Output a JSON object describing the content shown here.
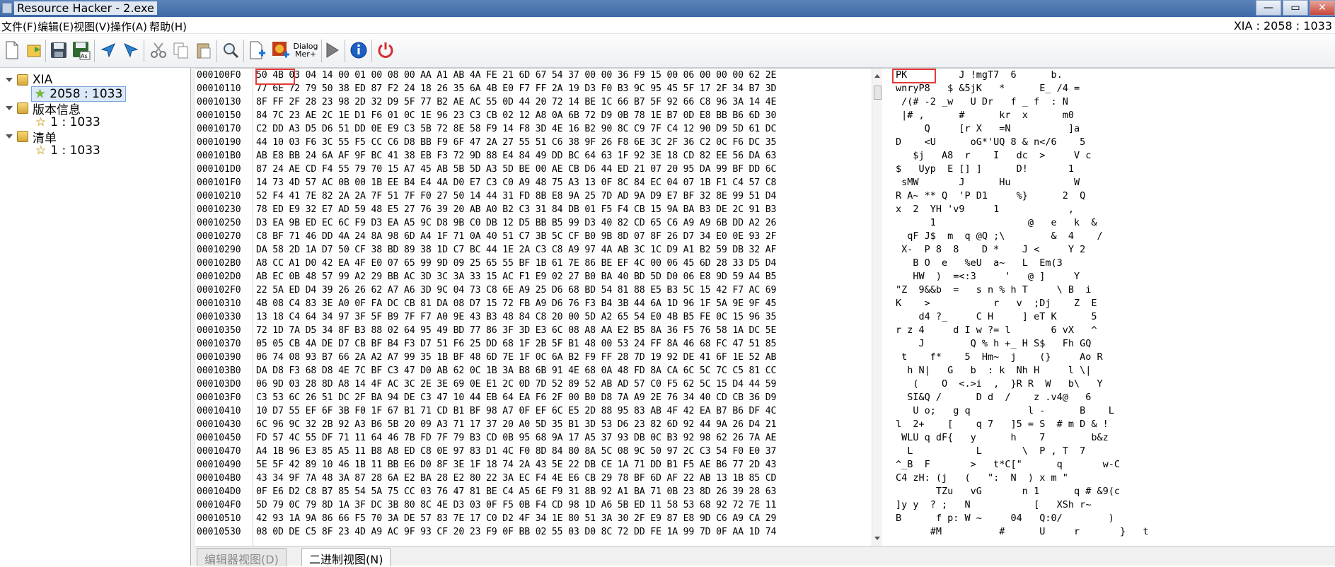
{
  "window": {
    "title": "Resource Hacker - 2.exe",
    "btn_min": "—",
    "btn_max": "▭",
    "btn_close": "✕"
  },
  "menu": {
    "items": [
      "文件(F)",
      "编辑(E)",
      "视图(V)",
      "操作(A)",
      "帮助(H)"
    ],
    "status": "XIA : 2058 : 1033"
  },
  "toolbar": {
    "dialog_menu_label1": "Dialog",
    "dialog_menu_label2": "Mer+"
  },
  "tree": {
    "n1": "XIA",
    "n1c": "2058 : 1033",
    "n2": "版本信息",
    "n2c": "1 : 1033",
    "n3": "清单",
    "n3c": "1 : 1033"
  },
  "hex": {
    "offsets": [
      "000100F0",
      "00010110",
      "00010130",
      "00010150",
      "00010170",
      "00010190",
      "000101B0",
      "000101D0",
      "000101F0",
      "00010210",
      "00010230",
      "00010250",
      "00010270",
      "00010290",
      "000102B0",
      "000102D0",
      "000102F0",
      "00010310",
      "00010330",
      "00010350",
      "00010370",
      "00010390",
      "000103B0",
      "000103D0",
      "000103F0",
      "00010410",
      "00010430",
      "00010450",
      "00010470",
      "00010490",
      "000104B0",
      "000104D0",
      "000104F0",
      "00010510",
      "00010530"
    ],
    "rows": [
      "50 4B 03 04 14 00 01 00 08 00 AA A1 AB 4A FE 21 6D 67 54 37 00 00 36 F9 15 00 06 00 00 00 62 2E",
      "77 6E 72 79 50 38 ED 87 F2 24 18 26 35 6A 4B E0 F7 FF 2A 19 D3 F0 B3 9C 95 45 5F 17 2F 34 B7 3D",
      "8F FF 2F 28 23 98 2D 32 D9 5F 77 B2 AE AC 55 0D 44 20 72 14 BE 1C 66 B7 5F 92 66 C8 96 3A 14 4E",
      "84 7C 23 AE 2C 1E D1 F6 01 0C 1E 96 23 C3 CB 02 12 A8 0A 6B 72 D9 0B 78 1E B7 0D E8 BB B6 6D 30",
      "C2 DD A3 D5 D6 51 DD 0E E9 C3 5B 72 8E 58 F9 14 F8 3D 4E 16 B2 90 8C C9 7F C4 12 90 D9 5D 61 DC",
      "44 10 03 F6 3C 55 F5 CC C6 D8 BB F9 6F 47 2A 27 55 51 C6 38 9F 26 F8 6E 3C 2F 36 C2 0C F6 DC 35",
      "AB E8 BB 24 6A AF 9F BC 41 38 EB F3 72 9D 88 E4 84 49 DD BC 64 63 1F 92 3E 18 CD 82 EE 56 DA 63",
      "87 24 AE CD F4 55 79 70 15 A7 45 AB 5B 5D A3 5D BE 00 AE CB D6 44 ED 21 07 20 95 DA 99 BF DD 6C",
      "14 73 4D 57 AC 0B 00 1B EE B4 E4 4A D0 E7 C3 C0 A9 48 75 A3 13 0F 8C 84 EC 04 07 1B F1 C4 57 C8",
      "52 F4 41 7E 82 2A 2A 7F 51 7F F0 27 50 14 44 31 FD 8B E8 9A 25 7D AD 9A D9 E7 BF 32 8E 99 51 D4",
      "78 ED E9 32 E7 AD 59 48 E5 27 76 39 20 AB A0 B2 C3 31 84 DB 01 F5 F4 CB 15 9A BA B3 DE 2C 91 B3",
      "D3 EA 9B ED EC 6C F9 D3 EA A5 9C D8 9B C0 DB 12 D5 BB B5 99 D3 40 82 CD 65 C6 A9 A9 6B DD A2 26",
      "C8 BF 71 46 DD 4A 24 8A 98 6D A4 1F 71 0A 40 51 C7 3B 5C CF B0 9B 8D 07 8F 26 D7 34 E0 0E 93 2F",
      "DA 58 2D 1A D7 50 CF 38 BD 89 38 1D C7 BC 44 1E 2A C3 C8 A9 97 4A AB 3C 1C D9 A1 B2 59 DB 32 AF",
      "A8 CC A1 D0 42 EA 4F E0 07 65 99 9D 09 25 65 55 BF 1B 61 7E 86 BE EF 4C 00 06 45 6D 28 33 D5 D4",
      "AB EC 0B 48 57 99 A2 29 BB AC 3D 3C 3A 33 15 AC F1 E9 02 27 B0 BA 40 BD 5D D0 06 E8 9D 59 A4 B5",
      "22 5A ED D4 39 26 26 62 A7 A6 3D 9C 04 73 C8 6E A9 25 D6 68 BD 54 81 88 E5 B3 5C 15 42 F7 AC 69",
      "4B 08 C4 83 3E A0 0F FA DC CB 81 DA 08 D7 15 72 FB A9 D6 76 F3 B4 3B 44 6A 1D 96 1F 5A 9E 9F 45",
      "13 18 C4 64 34 97 3F 5F B9 7F F7 A0 9E 43 B3 48 84 C8 20 00 5D A2 65 54 E0 4B B5 FE 0C 15 96 35",
      "72 1D 7A D5 34 8F B3 88 02 64 95 49 BD 77 86 3F 3D E3 6C 08 A8 AA E2 B5 8A 36 F5 76 58 1A DC 5E",
      "05 05 CB 4A DE D7 CB BF B4 F3 D7 51 F6 25 DD 68 1F 2B 5F B1 48 00 53 24 FF 8A 46 68 FC 47 51 85",
      "06 74 08 93 B7 66 2A A2 A7 99 35 1B BF 48 6D 7E 1F 0C 6A B2 F9 FF 28 7D 19 92 DE 41 6F 1E 52 AB",
      "DA D8 F3 68 D8 4E 7C BF C3 47 D0 AB 62 0C 1B 3A B8 6B 91 4E 68 0A 48 FD 8A CA 6C 5C 7C C5 81 CC",
      "06 9D 03 28 8D A8 14 4F AC 3C 2E 3E 69 0E E1 2C 0D 7D 52 89 52 AB AD 57 C0 F5 62 5C 15 D4 44 59",
      "C3 53 6C 26 51 DC 2F BA 94 DE C3 47 10 44 EB 64 EA F6 2F 00 B0 D8 7A A9 2E 76 34 40 CD CB 36 D9",
      "10 D7 55 EF 6F 3B F0 1F 67 B1 71 CD B1 BF 98 A7 0F EF 6C E5 2D 88 95 83 AB 4F 42 EA B7 B6 DF 4C",
      "6C 96 9C 32 2B 92 A3 B6 5B 20 09 A3 71 17 37 20 A0 5D 35 B1 3D 53 D6 23 82 6D 92 44 9A 26 D4 21",
      "FD 57 4C 55 DF 71 11 64 46 7B FD 7F 79 B3 CD 0B 95 68 9A 17 A5 37 93 DB 0C B3 92 98 62 26 7A AE",
      "A4 1B 96 E3 85 A5 11 B8 A8 ED C8 0E 97 83 D1 4C F0 8D 84 80 8A 5C 08 9C 50 97 2C C3 54 F0 E0 37",
      "5E 5F 42 89 10 46 1B 11 BB E6 D0 8F 3E 1F 18 74 2A 43 5E 22 DB CE 1A 71 DD B1 F5 AE B6 77 2D 43",
      "43 34 9F 7A 48 3A 87 28 6A E2 BA 28 E2 80 22 3A EC F4 4E E6 CB 29 78 BF 6D AF 22 AB 13 1B 85 CD",
      "0F E6 D2 C8 B7 85 54 5A 75 CC 03 76 47 81 BE C4 A5 6E F9 31 8B 92 A1 BA 71 0B 23 8D 26 39 28 63",
      "5D 79 0C 79 8D 1A 3F DC 3B 80 8C 4E D3 03 0F F5 0B F4 CD 98 1D A6 5B ED 11 58 53 68 92 72 7E 11",
      "42 93 1A 9A 86 66 F5 70 3A DE 57 83 7E 17 C0 D2 4F 34 1E 80 51 3A 30 2F E9 87 E8 9D C6 A9 CA 29",
      "08 0D DE C5 8F 23 4D A9 AC 9F 93 CF 20 23 F9 0F BB 02 55 03 D0 8C 72 DD FE 1A 99 7D 0F AA 1D 74"
    ],
    "ascii": [
      "PK         J !mgT7  6      b.",
      "wnryP8   $ &5jK   *      E_ /4 =",
      " /(# -2 _w   U Dr   f _ f  : N",
      " |# ,      #      kr  x      m0",
      "     Q     [r X   =N          ]a",
      "D    <U      oG*'UQ 8 & n</6    5",
      "   $j   A8  r    I   dc  >     V c",
      "$   Uyp  E [] ]      D!       1",
      " sMW       J      Hu           W",
      "R A~ ** Q  'P D1     %}      2  Q",
      "x  2  YH 'v9     1            ,",
      "      1                @   e   k  &",
      "  qF J$  m  q @Q ;\\        &  4    /",
      " X-  P 8  8    D *    J <     Y 2",
      "   B O  e   %eU  a~   L  Em(3",
      "   HW  )  =<:3     '   @ ]     Y",
      "\"Z  9&&b  =   s n % h T     \\ B  i",
      "K    >           r   v  ;Dj    Z  E",
      "    d4 ?_     C H     ] eT K      5",
      "r z 4     d I w ?= l       6 vX   ^",
      "    J        Q % h +_ H S$   Fh GQ",
      " t    f*    5  Hm~  j    (}     Ao R",
      "  h N|   G   b  : k  Nh H     l \\|",
      "   (    O  <.>i  ,  }R R  W   b\\   Y",
      "  SI&Q /      D d  /    z .v4@   6",
      "   U o;   g q          l -      B    L",
      "l  2+    [    q 7   ]5 = S  # m D & !",
      " WLU q dF{   y      h    7        b&z",
      "  L           L       \\  P , T  7",
      "^_B  F       >   t*C[\"      q       w-C",
      "C4 zH: (j   (   \":  N  ) x m \"",
      "       TZu   vG       n 1      q # &9(c",
      "]y y  ? ;   N           [   XSh r~",
      "B      f p: W ~     04   Q:0/        )",
      "      #M          #      U     r       }   t"
    ]
  },
  "tabs": {
    "editor": "编辑器视图(D)",
    "binary": "二进制视图(N)"
  }
}
